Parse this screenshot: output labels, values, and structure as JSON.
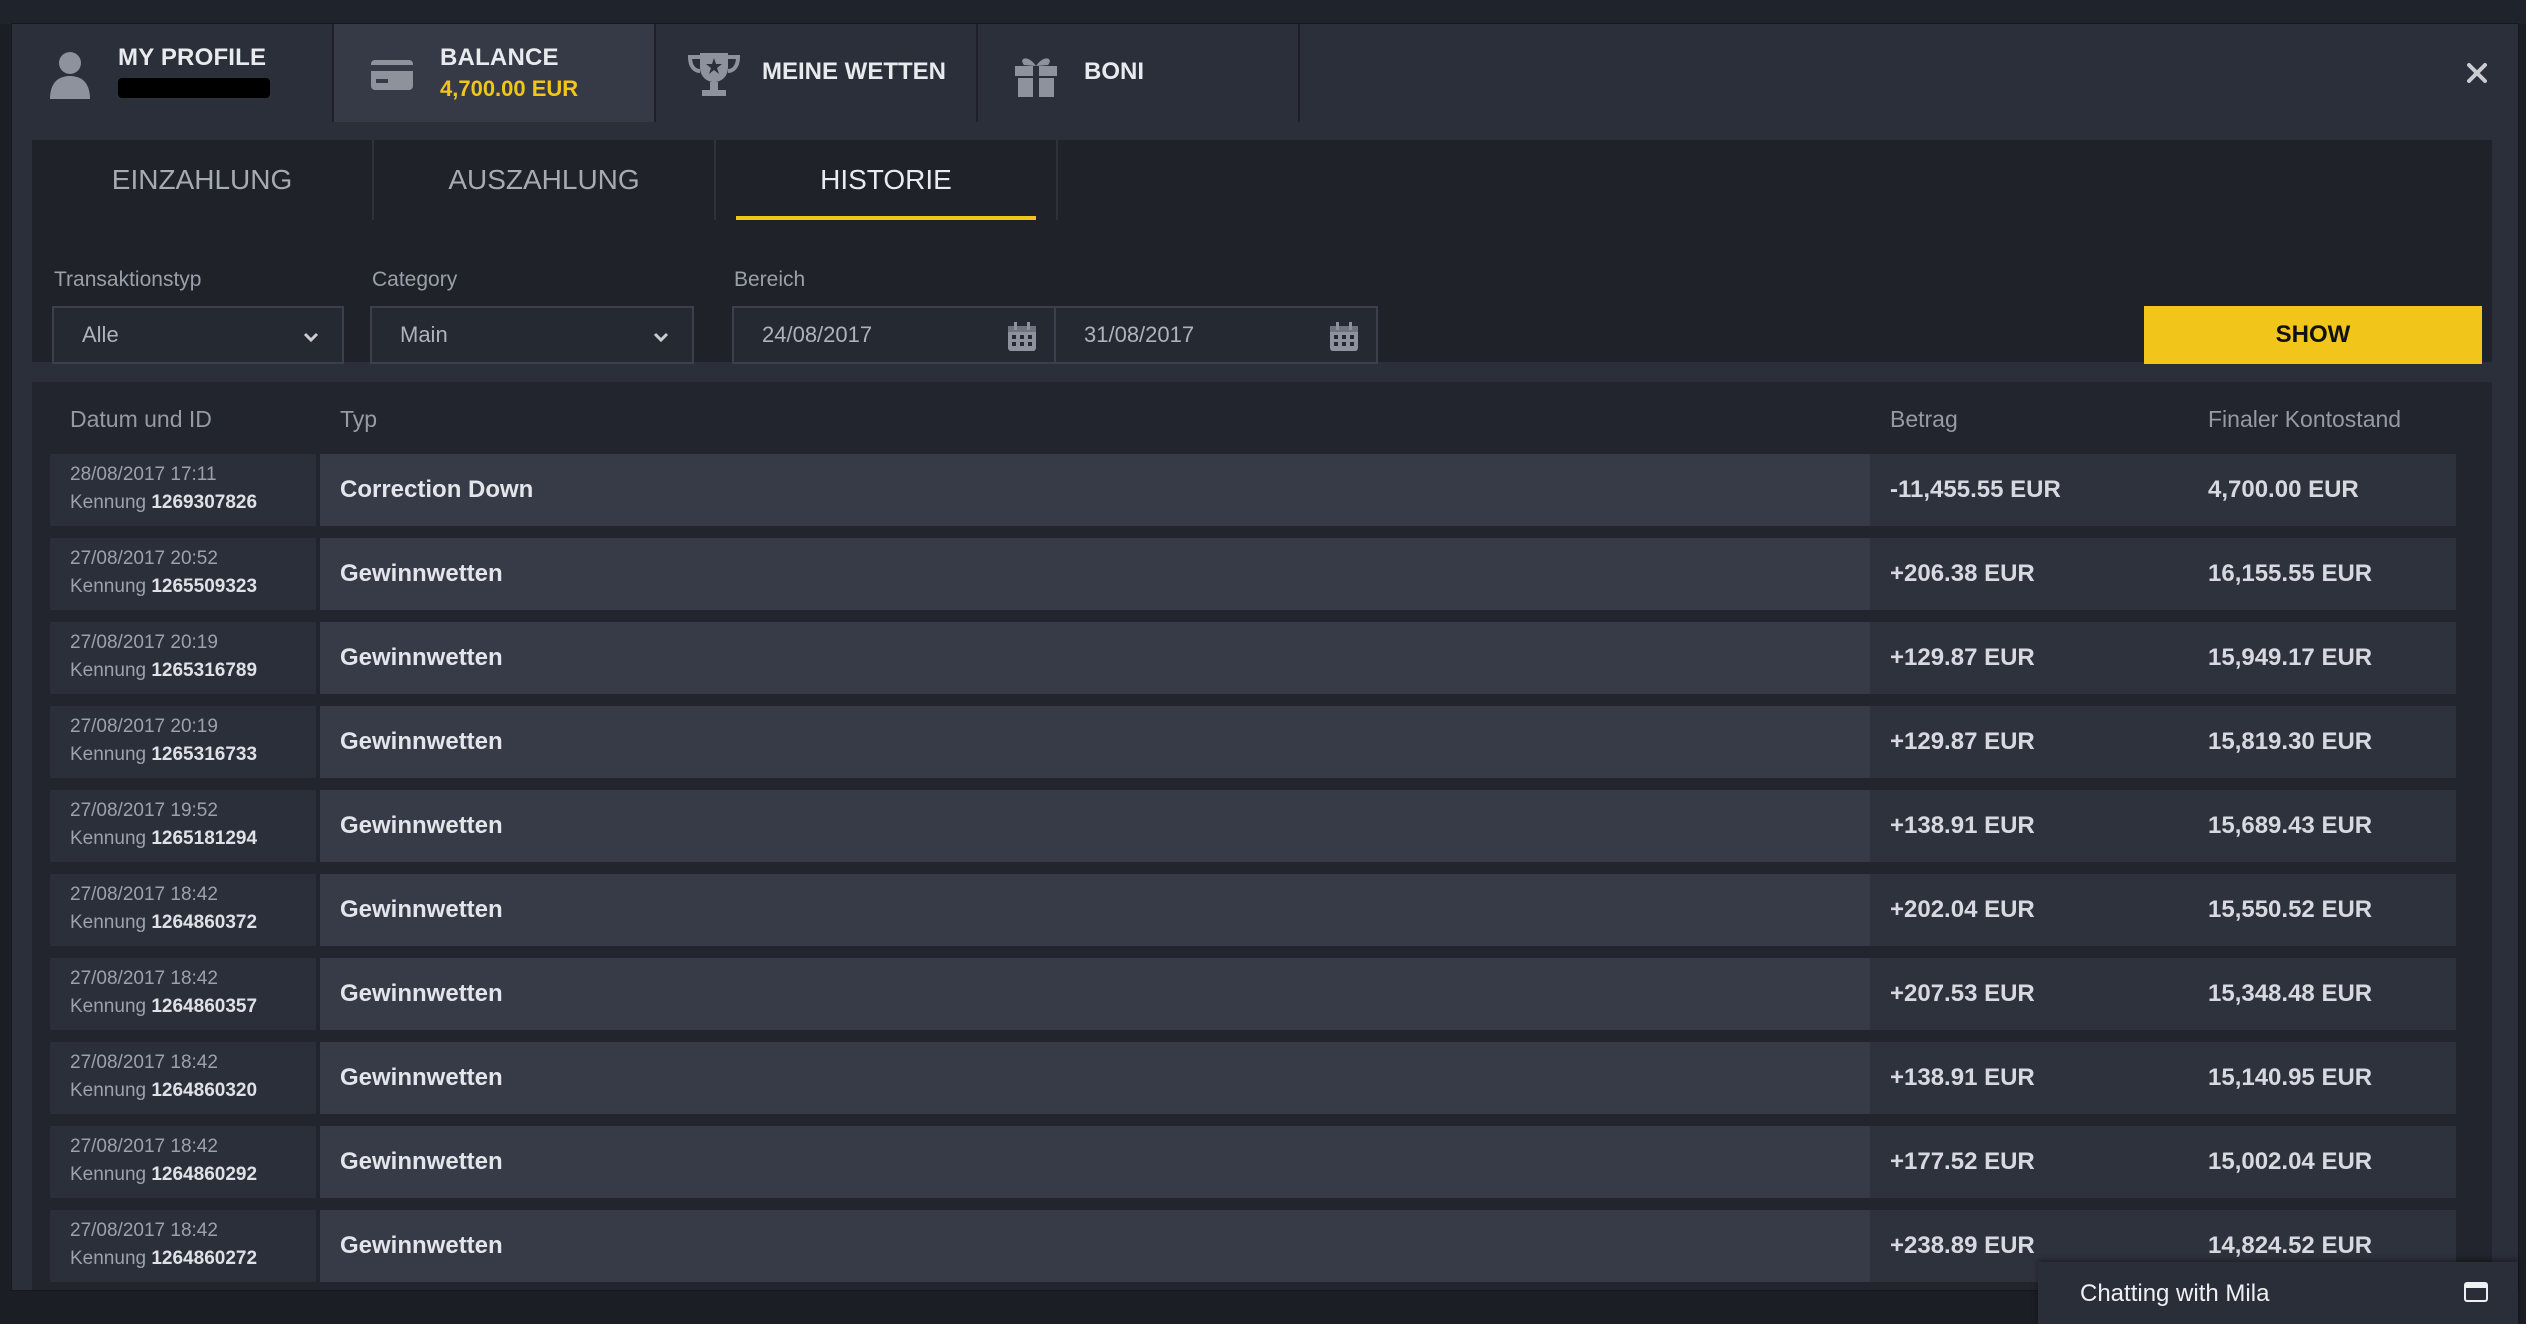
{
  "nav": {
    "profile": {
      "title": "MY PROFILE"
    },
    "balance": {
      "title": "BALANCE",
      "amount": "4,700.00 EUR"
    },
    "bets": {
      "title": "MEINE WETTEN"
    },
    "bonus": {
      "title": "BONI"
    }
  },
  "subtabs": [
    "EINZAHLUNG",
    "AUSZAHLUNG",
    "HISTORIE"
  ],
  "filters": {
    "type_label": "Transaktionstyp",
    "type_value": "Alle",
    "category_label": "Category",
    "category_value": "Main",
    "range_label": "Bereich",
    "date_from": "24/08/2017",
    "date_to": "31/08/2017",
    "show_label": "SHOW"
  },
  "table": {
    "headers": [
      "Datum und ID",
      "Typ",
      "Betrag",
      "Finaler Kontostand"
    ],
    "id_prefix": "Kennung",
    "rows": [
      {
        "date": "28/08/2017 17:11",
        "id": "1269307826",
        "type": "Correction Down",
        "amount": "-11,455.55 EUR",
        "final": "4,700.00 EUR"
      },
      {
        "date": "27/08/2017 20:52",
        "id": "1265509323",
        "type": "Gewinnwetten",
        "amount": "+206.38 EUR",
        "final": "16,155.55 EUR"
      },
      {
        "date": "27/08/2017 20:19",
        "id": "1265316789",
        "type": "Gewinnwetten",
        "amount": "+129.87 EUR",
        "final": "15,949.17 EUR"
      },
      {
        "date": "27/08/2017 20:19",
        "id": "1265316733",
        "type": "Gewinnwetten",
        "amount": "+129.87 EUR",
        "final": "15,819.30 EUR"
      },
      {
        "date": "27/08/2017 19:52",
        "id": "1265181294",
        "type": "Gewinnwetten",
        "amount": "+138.91 EUR",
        "final": "15,689.43 EUR"
      },
      {
        "date": "27/08/2017 18:42",
        "id": "1264860372",
        "type": "Gewinnwetten",
        "amount": "+202.04 EUR",
        "final": "15,550.52 EUR"
      },
      {
        "date": "27/08/2017 18:42",
        "id": "1264860357",
        "type": "Gewinnwetten",
        "amount": "+207.53 EUR",
        "final": "15,348.48 EUR"
      },
      {
        "date": "27/08/2017 18:42",
        "id": "1264860320",
        "type": "Gewinnwetten",
        "amount": "+138.91 EUR",
        "final": "15,140.95 EUR"
      },
      {
        "date": "27/08/2017 18:42",
        "id": "1264860292",
        "type": "Gewinnwetten",
        "amount": "+177.52 EUR",
        "final": "15,002.04 EUR"
      },
      {
        "date": "27/08/2017 18:42",
        "id": "1264860272",
        "type": "Gewinnwetten",
        "amount": "+238.89 EUR",
        "final": "14,824.52 EUR"
      }
    ]
  },
  "chat": {
    "label": "Chatting with Mila"
  },
  "colors": {
    "accent": "#f2c51a",
    "background": "#2b2f39"
  }
}
